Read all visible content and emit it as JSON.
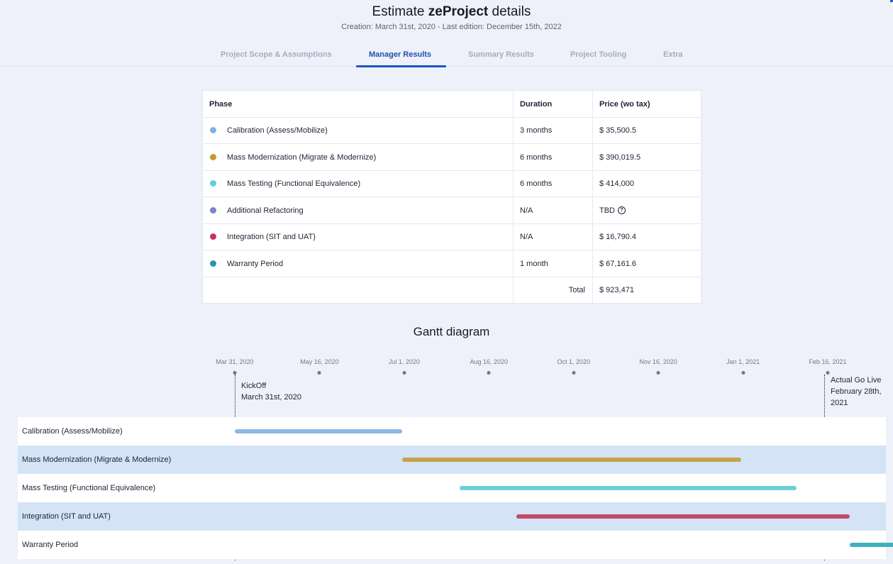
{
  "header": {
    "title_prefix": "Estimate ",
    "title_bold": "zeProject",
    "title_suffix": " details",
    "subtitle": "Creation: March 31st, 2020 - Last edition: December 15th, 2022"
  },
  "tabs": [
    {
      "label": "Project Scope & Assumptions",
      "active": false
    },
    {
      "label": "Manager Results",
      "active": true
    },
    {
      "label": "Summary Results",
      "active": false
    },
    {
      "label": "Project Tooling",
      "active": false
    },
    {
      "label": "Extra",
      "active": false
    }
  ],
  "phase_table": {
    "headers": [
      "Phase",
      "Duration",
      "Price (wo tax)"
    ],
    "rows": [
      {
        "phase": "Calibration (Assess/Mobilize)",
        "duration": "3 months",
        "price": "$ 35,500.5",
        "color": "#7fb2e3"
      },
      {
        "phase": "Mass Modernization (Migrate & Modernize)",
        "duration": "6 months",
        "price": "$ 390,019.5",
        "color": "#c49a2c"
      },
      {
        "phase": "Mass Testing (Functional Equivalence)",
        "duration": "6 months",
        "price": "$ 414,000",
        "color": "#62cfd9"
      },
      {
        "phase": "Additional Refactoring",
        "duration": "N/A",
        "price": "TBD",
        "color": "#7d82c9"
      },
      {
        "phase": "Integration (SIT and UAT)",
        "duration": "N/A",
        "price": "$ 16,790.4",
        "color": "#c8315a"
      },
      {
        "phase": "Warranty Period",
        "duration": "1 month",
        "price": "$ 67,161.6",
        "color": "#2596ad"
      }
    ],
    "total_label": "Total",
    "total_value": "$ 923,471",
    "help_icon": "question-circle-icon",
    "help_glyph": "?"
  },
  "gantt": {
    "title": "Gantt diagram",
    "dates": [
      "Mar 31, 2020",
      "May 16, 2020",
      "Jul 1, 2020",
      "Aug 16, 2020",
      "Oct 1, 2020",
      "Nov 16, 2020",
      "Jan 1, 2021",
      "Feb 16, 2021"
    ],
    "kickoff": {
      "line1": "KickOff",
      "line2": "March 31st, 2020"
    },
    "golive": {
      "line1": "Actual Go Live",
      "line2": "February 28th,",
      "line3": "2021"
    },
    "rows": [
      {
        "label": "Calibration (Assess/Mobilize)",
        "start": "2020-03-31",
        "end": "2020-06-30",
        "color": "#8cb8e6"
      },
      {
        "label": "Mass Modernization (Migrate & Modernize)",
        "start": "2020-06-30",
        "end": "2020-12-31",
        "color": "#c7a24a"
      },
      {
        "label": "Mass Testing (Functional Equivalence)",
        "start": "2020-07-31",
        "end": "2021-01-30",
        "color": "#6ccfd8"
      },
      {
        "label": "Integration (SIT and UAT)",
        "start": "2020-08-31",
        "end": "2021-02-28",
        "color": "#c54a67"
      },
      {
        "label": "Warranty Period",
        "start": "2021-02-28",
        "end": "2021-03-31",
        "color": "#3fb1c0"
      }
    ]
  }
}
